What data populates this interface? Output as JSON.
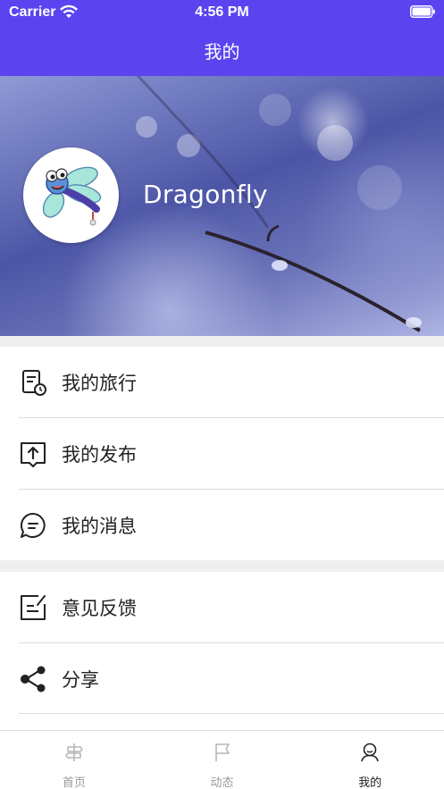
{
  "status_bar": {
    "carrier": "Carrier",
    "time": "4:56 PM",
    "wifi_icon": "wifi-icon",
    "battery_icon": "battery-icon"
  },
  "nav": {
    "title": "我的",
    "background": "#5b44f0"
  },
  "profile": {
    "username": "Dragonfly",
    "avatar_icon": "dragonfly-avatar"
  },
  "menu": {
    "items": [
      {
        "label": "我的旅行",
        "icon": "trip-list-icon"
      },
      {
        "label": "我的发布",
        "icon": "upload-icon"
      },
      {
        "label": "我的消息",
        "icon": "message-icon"
      },
      {
        "label": "意见反馈",
        "icon": "feedback-edit-icon"
      },
      {
        "label": "分享",
        "icon": "share-icon"
      }
    ]
  },
  "tabbar": {
    "tabs": [
      {
        "label": "首页",
        "icon": "home-signpost-icon",
        "active": false
      },
      {
        "label": "动态",
        "icon": "flag-icon",
        "active": false
      },
      {
        "label": "我的",
        "icon": "user-icon",
        "active": true
      }
    ]
  }
}
